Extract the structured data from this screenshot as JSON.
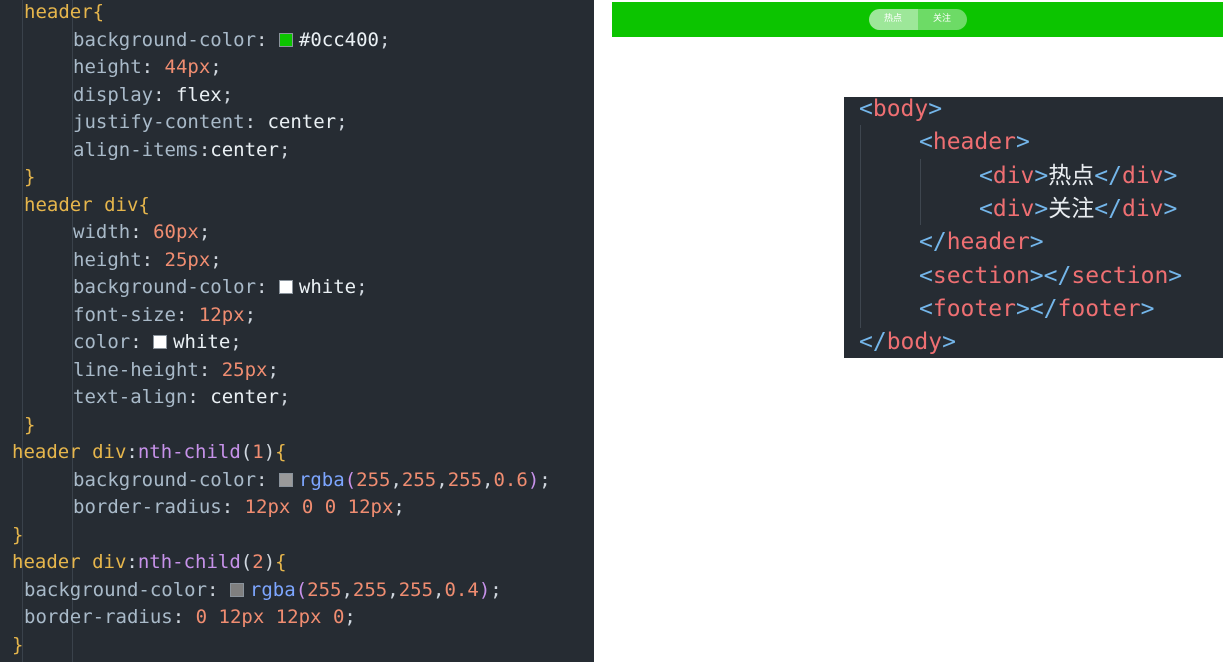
{
  "css_editor": {
    "lines": [
      [
        {
          "t": "header",
          "c": "sel"
        },
        {
          "t": "{",
          "c": "brace"
        }
      ],
      [
        {
          "t": "background-color",
          "c": "prop"
        },
        {
          "t": ": ",
          "c": "punc"
        },
        {
          "sw": "#0cc400"
        },
        {
          "t": "#0cc400",
          "c": "kw"
        },
        {
          "t": ";",
          "c": "punc"
        }
      ],
      [
        {
          "t": "height",
          "c": "prop"
        },
        {
          "t": ": ",
          "c": "punc"
        },
        {
          "t": "44px",
          "c": "num"
        },
        {
          "t": ";",
          "c": "punc"
        }
      ],
      [
        {
          "t": "display",
          "c": "prop"
        },
        {
          "t": ": ",
          "c": "punc"
        },
        {
          "t": "flex",
          "c": "kw"
        },
        {
          "t": ";",
          "c": "punc"
        }
      ],
      [
        {
          "t": "justify-content",
          "c": "prop"
        },
        {
          "t": ": ",
          "c": "punc"
        },
        {
          "t": "center",
          "c": "kw"
        },
        {
          "t": ";",
          "c": "punc"
        }
      ],
      [
        {
          "t": "align-items",
          "c": "prop"
        },
        {
          "t": ":",
          "c": "punc"
        },
        {
          "t": "center",
          "c": "kw"
        },
        {
          "t": ";",
          "c": "punc"
        }
      ],
      [
        {
          "t": "}",
          "c": "brace"
        }
      ],
      [
        {
          "t": "header div",
          "c": "sel"
        },
        {
          "t": "{",
          "c": "brace"
        }
      ],
      [
        {
          "t": "width",
          "c": "prop"
        },
        {
          "t": ": ",
          "c": "punc"
        },
        {
          "t": "60px",
          "c": "num"
        },
        {
          "t": ";",
          "c": "punc"
        }
      ],
      [
        {
          "t": "height",
          "c": "prop"
        },
        {
          "t": ": ",
          "c": "punc"
        },
        {
          "t": "25px",
          "c": "num"
        },
        {
          "t": ";",
          "c": "punc"
        }
      ],
      [
        {
          "t": "background-color",
          "c": "prop"
        },
        {
          "t": ": ",
          "c": "punc"
        },
        {
          "sw": "#ffffff"
        },
        {
          "t": "white",
          "c": "kw"
        },
        {
          "t": ";",
          "c": "punc"
        }
      ],
      [
        {
          "t": "font-size",
          "c": "prop"
        },
        {
          "t": ": ",
          "c": "punc"
        },
        {
          "t": "12px",
          "c": "num"
        },
        {
          "t": ";",
          "c": "punc"
        }
      ],
      [
        {
          "t": "color",
          "c": "prop"
        },
        {
          "t": ": ",
          "c": "punc"
        },
        {
          "sw": "#ffffff"
        },
        {
          "t": "white",
          "c": "kw"
        },
        {
          "t": ";",
          "c": "punc"
        }
      ],
      [
        {
          "t": "line-height",
          "c": "prop"
        },
        {
          "t": ": ",
          "c": "punc"
        },
        {
          "t": "25px",
          "c": "num"
        },
        {
          "t": ";",
          "c": "punc"
        }
      ],
      [
        {
          "t": "text-align",
          "c": "prop"
        },
        {
          "t": ": ",
          "c": "punc"
        },
        {
          "t": "center",
          "c": "kw"
        },
        {
          "t": ";",
          "c": "punc"
        }
      ],
      [
        {
          "t": "}",
          "c": "brace"
        }
      ],
      [
        {
          "t": "header div",
          "c": "sel"
        },
        {
          "t": ":",
          "c": "punc"
        },
        {
          "t": "nth-child",
          "c": "pseudo"
        },
        {
          "t": "(",
          "c": "punc"
        },
        {
          "t": "1",
          "c": "num"
        },
        {
          "t": ")",
          "c": "punc"
        },
        {
          "t": "{",
          "c": "brace"
        }
      ],
      [
        {
          "t": "background-color",
          "c": "prop"
        },
        {
          "t": ": ",
          "c": "punc"
        },
        {
          "sw": "#9a9a9a"
        },
        {
          "t": "rgba",
          "c": "fn"
        },
        {
          "t": "(",
          "c": "pseudo"
        },
        {
          "t": "255",
          "c": "num"
        },
        {
          "t": ",",
          "c": "punc"
        },
        {
          "t": "255",
          "c": "num"
        },
        {
          "t": ",",
          "c": "punc"
        },
        {
          "t": "255",
          "c": "num"
        },
        {
          "t": ",",
          "c": "punc"
        },
        {
          "t": "0.6",
          "c": "num"
        },
        {
          "t": ")",
          "c": "pseudo"
        },
        {
          "t": ";",
          "c": "punc"
        }
      ],
      [
        {
          "t": "border-radius",
          "c": "prop"
        },
        {
          "t": ": ",
          "c": "punc"
        },
        {
          "t": "12px",
          "c": "num"
        },
        {
          "t": " ",
          "c": "punc"
        },
        {
          "t": "0",
          "c": "num"
        },
        {
          "t": " ",
          "c": "punc"
        },
        {
          "t": "0",
          "c": "num"
        },
        {
          "t": " ",
          "c": "punc"
        },
        {
          "t": "12px",
          "c": "num"
        },
        {
          "t": ";",
          "c": "punc"
        }
      ],
      [
        {
          "t": "}",
          "c": "brace"
        }
      ],
      [
        {
          "t": "header div",
          "c": "sel"
        },
        {
          "t": ":",
          "c": "punc"
        },
        {
          "t": "nth-child",
          "c": "pseudo"
        },
        {
          "t": "(",
          "c": "punc"
        },
        {
          "t": "2",
          "c": "num"
        },
        {
          "t": ")",
          "c": "punc"
        },
        {
          "t": "{",
          "c": "brace"
        }
      ],
      [
        {
          "t": "background-color",
          "c": "prop"
        },
        {
          "t": ": ",
          "c": "punc"
        },
        {
          "sw": "#7f7f7f"
        },
        {
          "t": "rgba",
          "c": "fn"
        },
        {
          "t": "(",
          "c": "pseudo"
        },
        {
          "t": "255",
          "c": "num"
        },
        {
          "t": ",",
          "c": "punc"
        },
        {
          "t": "255",
          "c": "num"
        },
        {
          "t": ",",
          "c": "punc"
        },
        {
          "t": "255",
          "c": "num"
        },
        {
          "t": ",",
          "c": "punc"
        },
        {
          "t": "0.4",
          "c": "num"
        },
        {
          "t": ")",
          "c": "pseudo"
        },
        {
          "t": ";",
          "c": "punc"
        }
      ],
      [
        {
          "t": "border-radius",
          "c": "prop"
        },
        {
          "t": ": ",
          "c": "punc"
        },
        {
          "t": "0",
          "c": "num"
        },
        {
          "t": " ",
          "c": "punc"
        },
        {
          "t": "12px",
          "c": "num"
        },
        {
          "t": " ",
          "c": "punc"
        },
        {
          "t": "12px",
          "c": "num"
        },
        {
          "t": " ",
          "c": "punc"
        },
        {
          "t": "0",
          "c": "num"
        },
        {
          "t": ";",
          "c": "punc"
        }
      ],
      [
        {
          "t": "}",
          "c": "brace"
        }
      ]
    ]
  },
  "preview": {
    "header_color": "#0cc400",
    "tabs": [
      {
        "label": "热点",
        "bg": "rgba(255,255,255,0.6)"
      },
      {
        "label": "关注",
        "bg": "rgba(255,255,255,0.4)"
      }
    ]
  },
  "html_snippet": {
    "lines": [
      [
        {
          "t": "<",
          "c": "br"
        },
        {
          "t": "body",
          "c": "tag"
        },
        {
          "t": ">",
          "c": "br"
        }
      ],
      [
        {
          "t": "<",
          "c": "br"
        },
        {
          "t": "header",
          "c": "tag"
        },
        {
          "t": ">",
          "c": "br"
        }
      ],
      [
        {
          "t": "<",
          "c": "br"
        },
        {
          "t": "div",
          "c": "tag"
        },
        {
          "t": ">",
          "c": "br"
        },
        {
          "t": "热点",
          "c": "text"
        },
        {
          "t": "</",
          "c": "br"
        },
        {
          "t": "div",
          "c": "tag"
        },
        {
          "t": ">",
          "c": "br"
        }
      ],
      [
        {
          "t": "<",
          "c": "br"
        },
        {
          "t": "div",
          "c": "tag"
        },
        {
          "t": ">",
          "c": "br"
        },
        {
          "t": "关注",
          "c": "text"
        },
        {
          "t": "</",
          "c": "br"
        },
        {
          "t": "div",
          "c": "tag"
        },
        {
          "t": ">",
          "c": "br"
        }
      ],
      [
        {
          "t": "</",
          "c": "br"
        },
        {
          "t": "header",
          "c": "tag"
        },
        {
          "t": ">",
          "c": "br"
        }
      ],
      [
        {
          "t": "<",
          "c": "br"
        },
        {
          "t": "section",
          "c": "tag"
        },
        {
          "t": ">",
          "c": "br"
        },
        {
          "t": "</",
          "c": "br"
        },
        {
          "t": "section",
          "c": "tag"
        },
        {
          "t": ">",
          "c": "br"
        }
      ],
      [
        {
          "t": "<",
          "c": "br"
        },
        {
          "t": "footer",
          "c": "tag"
        },
        {
          "t": ">",
          "c": "br"
        },
        {
          "t": "</",
          "c": "br"
        },
        {
          "t": "footer",
          "c": "tag"
        },
        {
          "t": ">",
          "c": "br"
        }
      ],
      [
        {
          "t": "</",
          "c": "br"
        },
        {
          "t": "body",
          "c": "tag"
        },
        {
          "t": ">",
          "c": "br"
        }
      ]
    ]
  }
}
